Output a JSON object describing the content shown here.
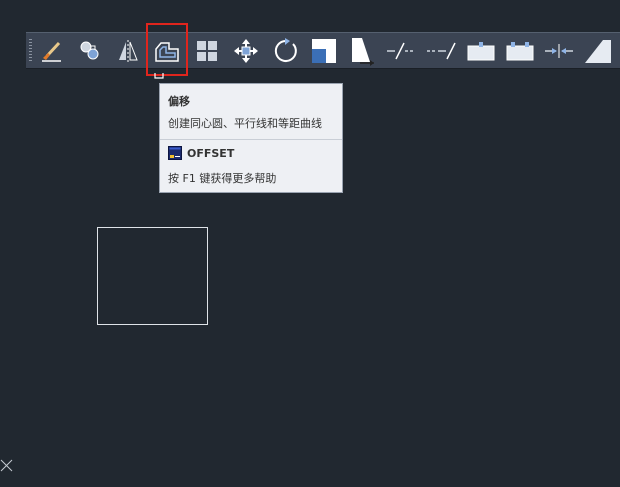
{
  "toolbar": {
    "buttons": [
      {
        "name": "erase",
        "icon": "erase-icon"
      },
      {
        "name": "copy",
        "icon": "copy-icon"
      },
      {
        "name": "mirror",
        "icon": "mirror-icon"
      },
      {
        "name": "offset",
        "icon": "offset-icon"
      },
      {
        "name": "array",
        "icon": "array-icon"
      },
      {
        "name": "move",
        "icon": "move-icon"
      },
      {
        "name": "rotate",
        "icon": "rotate-icon"
      },
      {
        "name": "scale",
        "icon": "scale-icon"
      },
      {
        "name": "stretch",
        "icon": "stretch-icon"
      },
      {
        "name": "trim",
        "icon": "trim-icon"
      },
      {
        "name": "extend",
        "icon": "extend-icon"
      },
      {
        "name": "break-at-point",
        "icon": "break-at-point-icon"
      },
      {
        "name": "break",
        "icon": "break-icon"
      },
      {
        "name": "join",
        "icon": "join-icon"
      },
      {
        "name": "chamfer",
        "icon": "chamfer-icon"
      }
    ],
    "active": "offset"
  },
  "tooltip": {
    "title": "偏移",
    "description": "创建同心圆、平行线和等距曲线",
    "command": "OFFSET",
    "help": "按 F1 键获得更多帮助"
  },
  "colors": {
    "background": "#212830",
    "toolbar": "#3b4453",
    "highlight": "#e0251d",
    "tooltip_bg": "#eef0f4"
  }
}
